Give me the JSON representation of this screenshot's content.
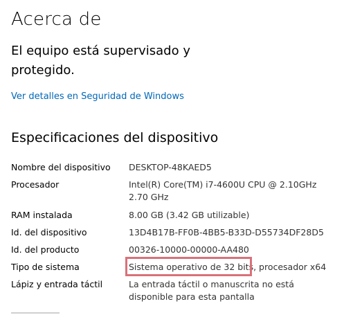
{
  "title": "Acerca de",
  "protection_status": "El equipo está supervisado y protegido.",
  "security_link": "Ver detalles en Seguridad de Windows",
  "specs": {
    "section_title": "Especificaciones del dispositivo",
    "rows": [
      {
        "label": "Nombre del dispositivo",
        "value": "DESKTOP-48KAED5"
      },
      {
        "label": "Procesador",
        "value": "Intel(R) Core(TM) i7-4600U CPU @ 2.10GHz 2.70 GHz"
      },
      {
        "label": "RAM instalada",
        "value": "8.00 GB (3.42 GB utilizable)"
      },
      {
        "label": "Id. del dispositivo",
        "value": "13D4B17B-FF0B-4BB5-B33D-D55734DF28D5"
      },
      {
        "label": "Id. del producto",
        "value": "00326-10000-00000-AA480"
      },
      {
        "label": "Tipo de sistema",
        "value": "Sistema operativo de 32 bits, procesador x64"
      },
      {
        "label": "Lápiz y entrada táctil",
        "value": "La entrada táctil o manuscrita no está disponible para esta pantalla"
      }
    ]
  },
  "accent_color": "#0067b8",
  "highlight_color": "#d9717a"
}
